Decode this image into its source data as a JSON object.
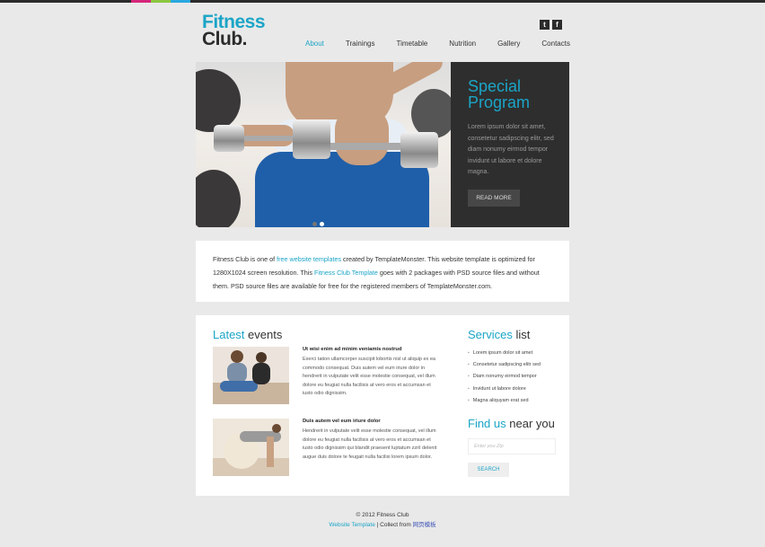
{
  "header": {
    "logo_line1": "Fitness",
    "logo_line2": "Club.",
    "social": [
      "twitter-icon",
      "facebook-icon"
    ],
    "nav": [
      "About",
      "Trainings",
      "Timetable",
      "Nutrition",
      "Gallery",
      "Contacts"
    ],
    "active_nav": "About"
  },
  "slider": {
    "title_line1": "Special",
    "title_line2": "Program",
    "text": "Lorem ipsum dolor sit amet, consetetur sadipscing elitr, sed diam nonumy eirmod tempor invidunt ut labore et dolore magna.",
    "button": "READ MORE",
    "slides_total": 2,
    "active_slide": 2
  },
  "intro": {
    "part1": "Fitness Club is one of ",
    "link1": "free website templates",
    "part2": " created by TemplateMonster. This website template is optimized for 1280X1024 screen resolution. This ",
    "link2": "Fitness Club Template",
    "part3": " goes with 2 packages  with PSD source files and without them. PSD source files are available for free for the registered members of TemplateMonster.com."
  },
  "events": {
    "title_hl": "Latest",
    "title_rest": " events",
    "items": [
      {
        "title": "Ut wisi enim ad minim veniamis nostrud",
        "body": "Exerci tation ullamcorper suscipit lobortis nisl ut aliquip ex ea commodo consequat. Duis autem vel eum iriure dolor in hendrerit in vulputate velit esse molestie consequat, vel illum dolore eu feugiat nulla facilisis at vero eros et accumsan et iusto odio dignissim."
      },
      {
        "title": "Duis autem vel eum iriure dolor",
        "body": "Hendrerit in vulputate velit esse molestie consequat, vel illum dolore eu feugiat nulla facilisis at vero eros et accumsan et iusto odio dignissim qui blandit praesent luptatum zzril delenit augue duis dolore te feugait nulla facilisi lorem ipsum dolor."
      }
    ]
  },
  "services": {
    "title_hl": "Services",
    "title_rest": " list",
    "items": [
      "Lorem ipsum dolor sit amet",
      "Consetetur sadipscing elitr sed",
      "Diam nonumy eirmod tempor",
      "Invidunt ut labore dolore",
      "Magna aliquyam erat sed"
    ]
  },
  "find": {
    "title_hl": "Find us",
    "title_rest": " near you",
    "zip_placeholder": "Enter you Zip",
    "search_label": "SEARCH"
  },
  "footer": {
    "copyright": "© 2012 Fitness Club",
    "link1": "Website Template",
    "sep": " | Collect from ",
    "link2": "网页模板"
  }
}
